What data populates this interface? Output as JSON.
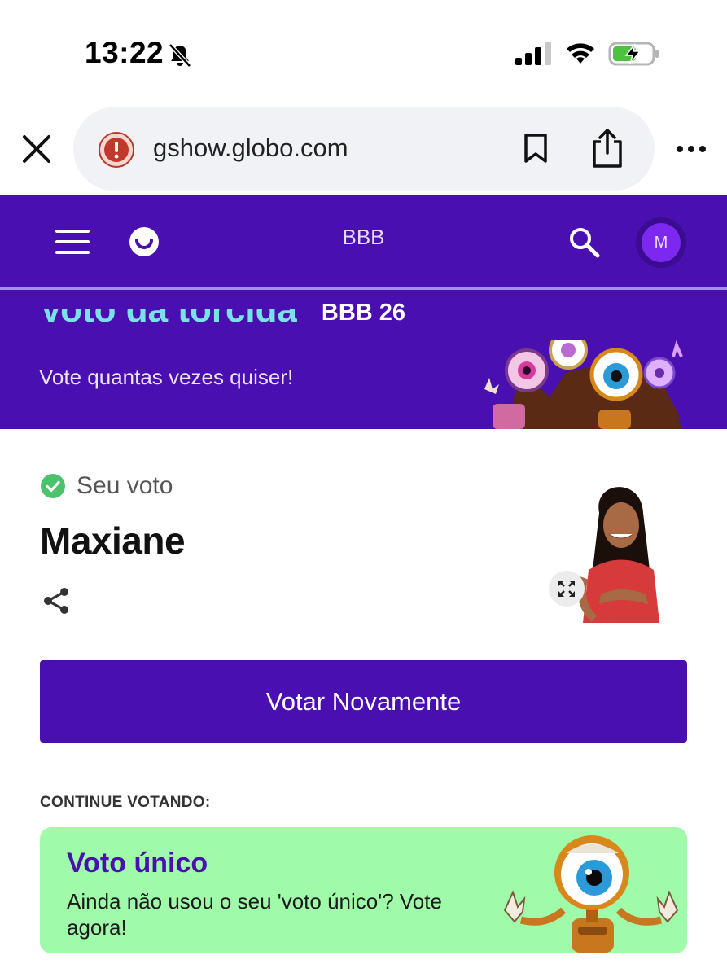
{
  "status_bar": {
    "time": "13:22",
    "icons": [
      "bell-slash-icon",
      "signal-icon",
      "wifi-icon",
      "battery-charging-icon"
    ]
  },
  "browser": {
    "url": "gshow.globo.com",
    "icons": [
      "close-icon",
      "alert-icon",
      "bookmark-icon",
      "share-icon",
      "more-icon"
    ]
  },
  "header": {
    "title": "BBB",
    "avatar_initial": "M",
    "icons": [
      "menu-icon",
      "gshow-logo",
      "search-icon"
    ]
  },
  "hero": {
    "label": "BBB 26",
    "title": "Voto da torcida",
    "subtitle": "Vote quantas vezes quiser!"
  },
  "result": {
    "status_label": "Seu voto",
    "candidate": "Maxiane"
  },
  "actions": {
    "vote_again": "Votar Novamente"
  },
  "continue": {
    "label": "CONTINUE VOTANDO:",
    "card_title": "Voto único",
    "card_desc": "Ainda não usou o seu 'voto único'? Vote agora!"
  },
  "colors": {
    "brand_purple": "#4a0fb0",
    "card_green": "#9ffaa9",
    "check_green": "#4cc36a"
  }
}
